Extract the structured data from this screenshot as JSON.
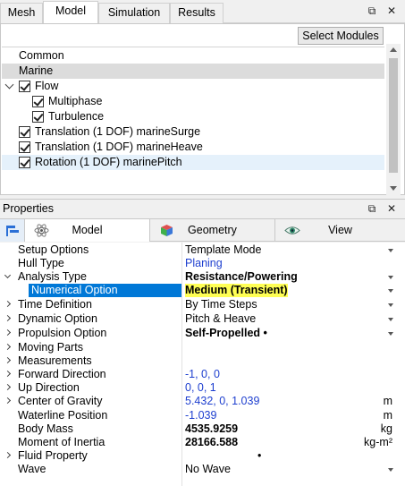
{
  "top_tabs": [
    "Mesh",
    "Model",
    "Simulation",
    "Results"
  ],
  "window_buttons": [
    "restore-icon",
    "close-icon"
  ],
  "modules": {
    "select_button": "Select Modules",
    "items": [
      {
        "label": "Common"
      },
      {
        "label": "Marine"
      },
      {
        "label": "Flow",
        "checked": true,
        "expanded": true
      },
      {
        "label": "Multiphase",
        "checked": true
      },
      {
        "label": "Turbulence",
        "checked": true
      },
      {
        "label": "Translation (1 DOF) marineSurge",
        "checked": true
      },
      {
        "label": "Translation (1 DOF) marineHeave",
        "checked": true
      },
      {
        "label": "Rotation (1 DOF) marinePitch",
        "checked": true
      }
    ]
  },
  "properties": {
    "title": "Properties",
    "tabs": [
      "Model",
      "Geometry",
      "View"
    ],
    "rows": [
      {
        "name": "Setup Options",
        "value": "Template Mode"
      },
      {
        "name": "Hull Type",
        "value": "Planing"
      },
      {
        "name": "Analysis Type",
        "value": "Resistance/Powering"
      },
      {
        "name": "Numerical Option",
        "value": "Medium (Transient)"
      },
      {
        "name": "Time Definition",
        "value": "By Time Steps"
      },
      {
        "name": "Dynamic Option",
        "value": "Pitch & Heave"
      },
      {
        "name": "Propulsion Option",
        "value": "Self-Propelled •"
      },
      {
        "name": "Moving Parts",
        "value": ""
      },
      {
        "name": "Measurements",
        "value": ""
      },
      {
        "name": "Forward Direction",
        "value": "-1, 0, 0"
      },
      {
        "name": "Up Direction",
        "value": "0, 0, 1"
      },
      {
        "name": "Center of Gravity",
        "value": "5.432, 0, 1.039",
        "unit": "m"
      },
      {
        "name": "Waterline Position",
        "value": "-1.039",
        "unit": "m"
      },
      {
        "name": "Body Mass",
        "value": "4535.9259",
        "unit": "kg"
      },
      {
        "name": "Moment of Inertia",
        "value": "28166.588",
        "unit": "kg-m²"
      },
      {
        "name": "Fluid Property",
        "value": "•"
      },
      {
        "name": "Wave",
        "value": "No Wave"
      }
    ]
  }
}
